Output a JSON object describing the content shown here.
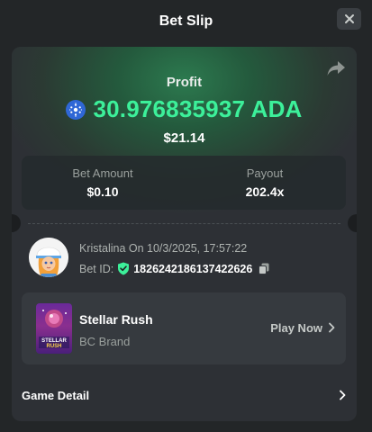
{
  "header": {
    "title": "Bet Slip",
    "close_icon": "close-icon"
  },
  "result": {
    "profit_label": "Profit",
    "profit_value": "30.976835937 ADA",
    "currency_icon": "cardano-ada-icon",
    "usd_value": "$21.14",
    "share_icon": "share-icon",
    "accent_color": "#3cf09a"
  },
  "stats": {
    "bet_amount_label": "Bet Amount",
    "bet_amount_value": "$0.10",
    "payout_label": "Payout",
    "payout_value": "202.4x"
  },
  "user": {
    "name_date": "Kristalina On 10/3/2025, 17:57:22",
    "bet_id_label": "Bet ID:",
    "bet_id_value": "1826242186137422626",
    "verified_icon": "shield-check-icon",
    "copy_icon": "copy-icon"
  },
  "game": {
    "name": "Stellar Rush",
    "brand": "BC Brand",
    "thumb_text": "STELLAR RUSH",
    "play_label": "Play Now"
  },
  "detail": {
    "label": "Game Detail"
  }
}
